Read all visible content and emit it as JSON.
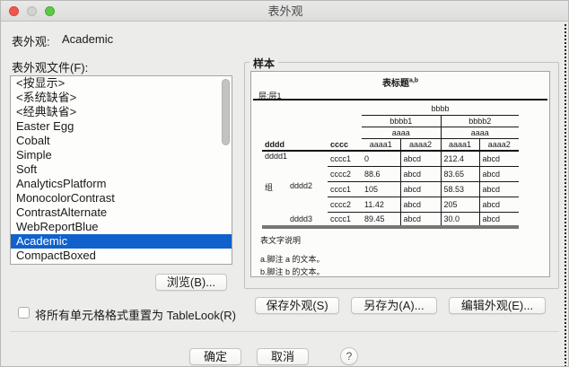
{
  "window": {
    "title": "表外观",
    "help": "?"
  },
  "colors": {
    "selection_blue": "#1161cd",
    "window_background": "#ececea",
    "table_bottom_bar": "#767674"
  },
  "header": {
    "current_label": "表外观:",
    "current_value": "Academic"
  },
  "file_list": {
    "label": "表外观文件(F):",
    "selected_index": 11,
    "items": [
      "<按显示>",
      "<系统缺省>",
      "<经典缺省>",
      "Easter Egg",
      "Cobalt",
      "Simple",
      "Soft",
      "AnalyticsPlatform",
      "MonocolorContrast",
      "ContrastAlternate",
      "WebReportBlue",
      "Academic",
      "CompactBoxed"
    ]
  },
  "buttons": {
    "browse": "浏览(B)...",
    "save": "保存外观(S)",
    "save_as": "另存为(A)...",
    "edit": "编辑外观(E)...",
    "ok": "确定",
    "cancel": "取消"
  },
  "reset_checkbox": {
    "label": "将所有单元格格式重置为 TableLook(R)",
    "checked": false
  },
  "sample": {
    "group_label": "样本",
    "table_title": "表标题",
    "table_title_sup": "a,b",
    "layer_label": "层:层1",
    "caption": "表文字说明",
    "footnotes": [
      "a.脚注 a 的文本。",
      "b.脚注 b 的文本。"
    ],
    "preview": {
      "col_group_header": "bbbb",
      "sub_headers": [
        "bbbb1",
        "bbbb2"
      ],
      "aaaa_headers": [
        "aaaa",
        "aaaa"
      ],
      "corner_headers": [
        "dddd",
        "cccc"
      ],
      "col_headers": [
        "aaaa1",
        "aaaa2",
        "aaaa1",
        "aaaa2"
      ],
      "group_label": "组",
      "rows": [
        {
          "group": "",
          "label": "dddd1",
          "sub": "cccc1",
          "values": [
            "0",
            "abcd",
            "212.4",
            "abcd"
          ]
        },
        {
          "group": "",
          "label": "",
          "sub": "cccc2",
          "values": [
            "88.6",
            "abcd",
            "83.65",
            "abcd"
          ]
        },
        {
          "group": "组",
          "label": "dddd2",
          "sub": "cccc1",
          "values": [
            "105",
            "abcd",
            "58.53",
            "abcd"
          ]
        },
        {
          "group": "",
          "label": "",
          "sub": "cccc2",
          "values": [
            "11.42",
            "abcd",
            "205",
            "abcd"
          ]
        },
        {
          "group": "",
          "label": "dddd3",
          "sub": "cccc1",
          "values": [
            "89.45",
            "abcd",
            "30.0",
            "abcd"
          ]
        }
      ]
    }
  }
}
